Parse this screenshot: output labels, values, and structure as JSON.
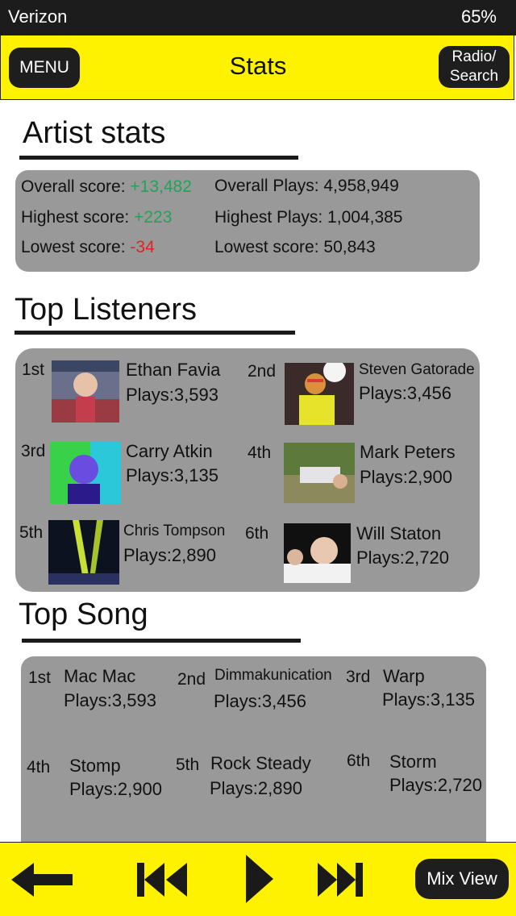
{
  "status": {
    "carrier": "Verizon",
    "battery": "65%"
  },
  "header": {
    "menu_label": "MENU",
    "title": "Stats",
    "radio_label_1": "Radio/",
    "radio_label_2": "Search"
  },
  "artist_stats": {
    "heading": "Artist stats",
    "overall_score_label": "Overall score:",
    "overall_score_value": "+13,482",
    "highest_score_label": "Highest score:",
    "highest_score_value": "+223",
    "lowest_score_label": "Lowest score:",
    "lowest_score_value": "-34",
    "overall_plays": "Overall Plays: 4,958,949",
    "highest_plays": "Highest Plays: 1,004,385",
    "lowest_plays": "Lowest score: 50,843",
    "positive_color": "#22a35a",
    "negative_color": "#e32222"
  },
  "top_listeners": {
    "heading": "Top Listeners",
    "items": [
      {
        "rank": "1st",
        "name": "Ethan Favia",
        "plays": "Plays:3,593"
      },
      {
        "rank": "2nd",
        "name": "Steven Gatorade",
        "plays": "Plays:3,456"
      },
      {
        "rank": "3rd",
        "name": "Carry Atkin",
        "plays": "Plays:3,135"
      },
      {
        "rank": "4th",
        "name": "Mark Peters",
        "plays": "Plays:2,900"
      },
      {
        "rank": "5th",
        "name": "Chris Tompson",
        "plays": "Plays:2,890"
      },
      {
        "rank": "6th",
        "name": "Will Staton",
        "plays": "Plays:2,720"
      }
    ]
  },
  "top_song": {
    "heading": "Top Song",
    "items": [
      {
        "rank": "1st",
        "name": "Mac Mac",
        "plays": "Plays:3,593"
      },
      {
        "rank": "2nd",
        "name": "Dimmakunication",
        "plays": "Plays:3,456"
      },
      {
        "rank": "3rd",
        "name": "Warp",
        "plays": "Plays:3,135"
      },
      {
        "rank": "4th",
        "name": "Stomp",
        "plays": "Plays:2,900"
      },
      {
        "rank": "5th",
        "name": "Rock Steady",
        "plays": "Plays:2,890"
      },
      {
        "rank": "6th",
        "name": "Storm",
        "plays": "Plays:2,720"
      }
    ]
  },
  "player": {
    "mix_view_label": "Mix View",
    "icons": [
      "back-arrow-icon",
      "previous-track-icon",
      "play-icon",
      "next-track-icon"
    ]
  },
  "theme": {
    "accent": "#fff200",
    "panel": "#999999",
    "dark": "#1e1e1e"
  }
}
